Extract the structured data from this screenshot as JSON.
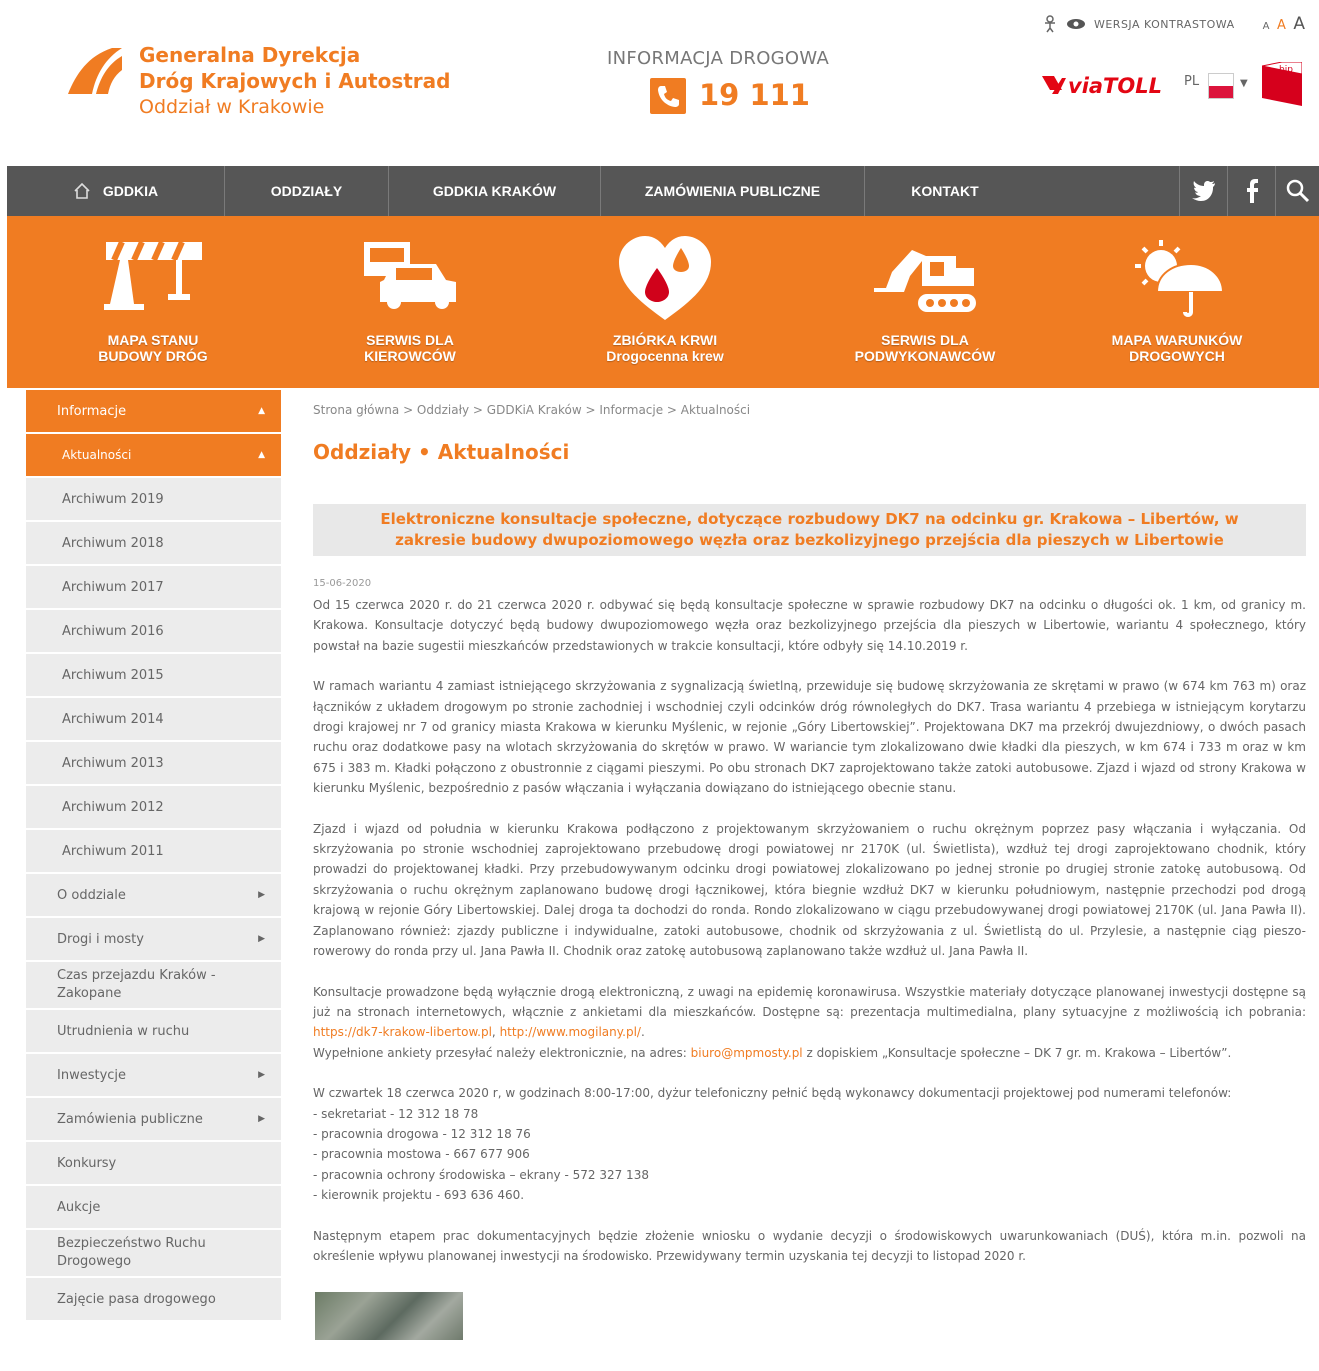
{
  "header": {
    "org_line1": "Generalna Dyrekcja",
    "org_line2": "Dróg Krajowych i Autostrad",
    "org_line3": "Oddział w Krakowie",
    "info_label": "INFORMACJA DROGOWA",
    "info_number": "19 111",
    "contrast_label": "WERSJA KONTRASTOWA",
    "font_sizes": [
      "A",
      "A",
      "A"
    ],
    "viatoll_text": "viaTOLL",
    "lang": "PL",
    "bip_text": "bip",
    "accent_color": "#f07c22"
  },
  "nav": {
    "items": [
      "GDDKIA",
      "ODDZIAŁY",
      "GDDKIA KRAKÓW",
      "ZAMÓWIENIA PUBLICZNE",
      "KONTAKT"
    ]
  },
  "band": {
    "items": [
      {
        "line1": "MAPA STANU",
        "line2": "BUDOWY DRÓG"
      },
      {
        "line1": "SERWIS DLA",
        "line2": "KIEROWCÓW"
      },
      {
        "line1": "ZBIÓRKA KRWI",
        "line2": "Drogocenna krew"
      },
      {
        "line1": "SERWIS DLA",
        "line2": "PODWYKONAWCÓW"
      },
      {
        "line1": "MAPA WARUNKÓW",
        "line2": "DROGOWYCH"
      }
    ]
  },
  "sidebar": {
    "items": [
      {
        "label": "Informacje"
      },
      {
        "label": "Aktualności"
      },
      {
        "label": "Archiwum 2019"
      },
      {
        "label": "Archiwum 2018"
      },
      {
        "label": "Archiwum 2017"
      },
      {
        "label": "Archiwum 2016"
      },
      {
        "label": "Archiwum 2015"
      },
      {
        "label": "Archiwum 2014"
      },
      {
        "label": "Archiwum 2013"
      },
      {
        "label": "Archiwum 2012"
      },
      {
        "label": "Archiwum 2011"
      },
      {
        "label": "O oddziale"
      },
      {
        "label": "Drogi i mosty"
      },
      {
        "label": "Czas przejazdu Kraków -",
        "label2": "Zakopane"
      },
      {
        "label": "Utrudnienia w ruchu"
      },
      {
        "label": "Inwestycje"
      },
      {
        "label": "Zamówienia publiczne"
      },
      {
        "label": "Konkursy"
      },
      {
        "label": "Aukcje"
      },
      {
        "label": "Bezpieczeństwo Ruchu",
        "label2": "Drogowego"
      },
      {
        "label": "Zajęcie pasa drogowego"
      }
    ]
  },
  "main": {
    "breadcrumb": "Strona główna > Oddziały > GDDKiA Kraków > Informacje > Aktualności",
    "page_title": "Oddziały • Aktualności",
    "article_title": "Elektroniczne konsultacje społeczne, dotyczące rozbudowy DK7 na odcinku gr. Krakowa – Libertów, w zakresie budowy dwupoziomowego węzła oraz bezkolizyjnego przejścia dla pieszych w Libertowie",
    "date": "15-06-2020",
    "p1": "Od 15 czerwca 2020 r. do 21 czerwca 2020 r. odbywać się będą konsultacje społeczne w sprawie rozbudowy DK7 na odcinku o długości ok. 1 km, od granicy m. Krakowa. Konsultacje dotyczyć będą budowy dwupoziomowego węzła oraz bezkolizyjnego przejścia dla pieszych w Libertowie, wariantu 4 społecznego, który powstał na bazie sugestii mieszkańców przedstawionych w trakcie konsultacji, które odbyły się 14.10.2019 r.",
    "p2": "W ramach wariantu 4 zamiast istniejącego skrzyżowania z sygnalizacją świetlną, przewiduje się budowę skrzyżowania ze skrętami w prawo (w 674 km 763 m) oraz łączników z układem drogowym po stronie zachodniej i wschodniej czyli odcinków dróg równoległych do DK7. Trasa wariantu 4 przebiega w istniejącym korytarzu drogi krajowej nr 7 od granicy miasta Krakowa w kierunku Myślenic, w rejonie „Góry Libertowskiej”. Projektowana DK7 ma przekrój dwujezdniowy, o dwóch pasach ruchu oraz dodatkowe pasy na wlotach skrzyżowania do skrętów w prawo. W wariancie tym zlokalizowano dwie kładki dla pieszych, w km 674 i 733 m oraz w km 675 i 383 m. Kładki połączono z obustronnie z ciągami pieszymi. Po obu stronach DK7 zaprojektowano także zatoki autobusowe. Zjazd i wjazd od strony Krakowa w kierunku Myślenic, bezpośrednio z pasów włączania i wyłączania dowiązano do istniejącego obecnie stanu.",
    "p3": "Zjazd i wjazd od południa w kierunku Krakowa podłączono z projektowanym skrzyżowaniem o ruchu okrężnym poprzez pasy włączania i wyłączania. Od skrzyżowania po stronie wschodniej zaprojektowano przebudowę drogi powiatowej nr 2170K (ul. Świetlista), wzdłuż tej drogi zaprojektowano chodnik, który prowadzi do projektowanej kładki. Przy przebudowywanym odcinku drogi powiatowej zlokalizowano po jednej stronie po drugiej stronie zatokę autobusową. Od skrzyżowania o ruchu okrężnym zaplanowano budowę drogi łącznikowej, która biegnie wzdłuż DK7 w kierunku południowym, następnie przechodzi pod drogą krajową w rejonie Góry Libertowskiej. Dalej droga ta dochodzi do ronda. Rondo zlokalizowano w ciągu przebudowywanej drogi powiatowej 2170K (ul. Jana Pawła II). Zaplanowano również: zjazdy publiczne i indywidualne, zatoki autobusowe, chodnik od skrzyżowania z ul. Świetlistą do ul. Przylesie, a następnie ciąg pieszo-rowerowy do ronda przy ul. Jana Pawła II. Chodnik oraz zatokę autobusową zaplanowano także wzdłuż ul. Jana Pawła II.",
    "p4a": "Konsultacje prowadzone będą wyłącznie drogą elektroniczną, z uwagi na epidemię koronawirusa. Wszystkie materiały dotyczące planowanej inwestycji dostępne są już na stronach internetowych, włącznie z ankietami dla mieszkańców. Dostępne są: prezentacja multimedialna, plany sytuacyjne z możliwością ich pobrania:",
    "link1": "https://dk7-krakow-libertow.pl",
    "link2": "http://www.mogilany.pl/",
    "p4b_pre": "Wypełnione ankiety przesyłać należy elektronicznie, na adres:",
    "email": "biuro@mpmosty.pl",
    "p4b_post": "z dopiskiem „Konsultacje społeczne – DK 7 gr. m. Krakowa – Libertów”.",
    "p5": "W czwartek 18 czerwca 2020 r, w godzinach 8:00-17:00, dyżur telefoniczny pełnić będą wykonawcy dokumentacji projektowej pod numerami telefonów:",
    "phones": [
      "- sekretariat - 12 312 18 78",
      "- pracownia drogowa - 12 312 18 76",
      "- pracownia mostowa - 667 677 906",
      "- pracownia ochrony środowiska – ekrany - 572 327 138",
      "- kierownik projektu - 693 636 460."
    ],
    "p6": "Następnym etapem prac dokumentacyjnych będzie złożenie wniosku o wydanie decyzji o środowiskowych uwarunkowaniach (DUŚ), która m.in. pozwoli na określenie wpływu planowanej inwestycji na środowisko. Przewidywany termin uzyskania tej decyzji to listopad 2020 r."
  }
}
